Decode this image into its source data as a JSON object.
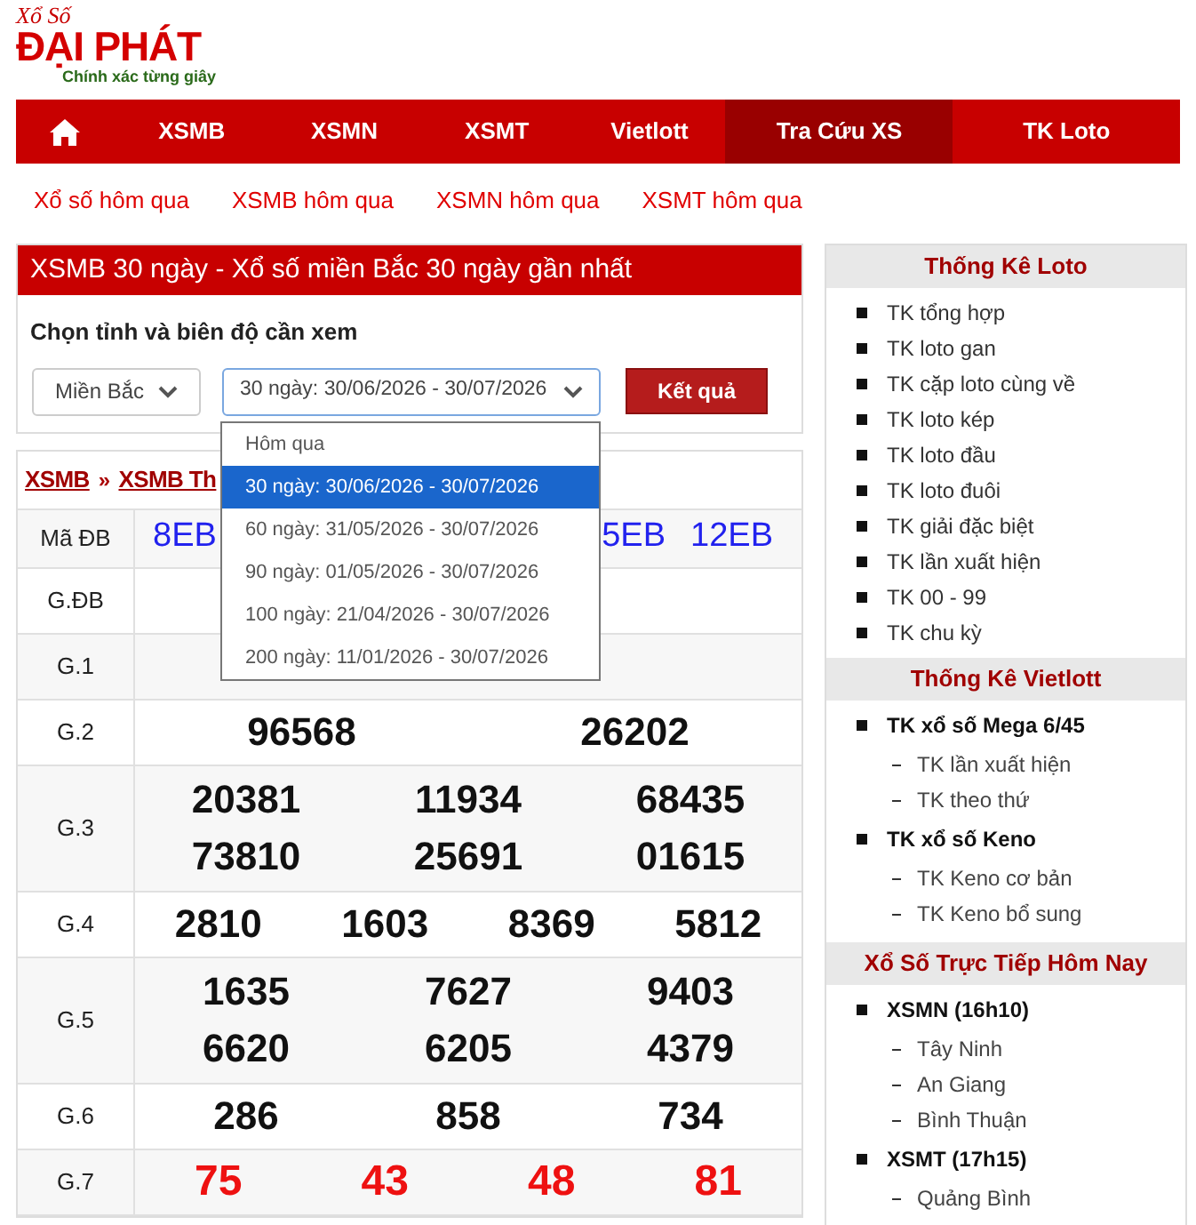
{
  "logo": {
    "brand_top": "Xổ Số",
    "brand": "ĐẠI PHÁT",
    "tagline": "Chính xác từng giây"
  },
  "nav": [
    {
      "kind": "home",
      "selected": false
    },
    {
      "kind": "text",
      "label": "XSMB",
      "selected": false
    },
    {
      "kind": "text",
      "label": "XSMN",
      "selected": false
    },
    {
      "kind": "text",
      "label": "XSMT",
      "selected": false
    },
    {
      "kind": "text",
      "label": "Vietlott",
      "selected": false
    },
    {
      "kind": "text",
      "label": "Tra Cứu XS",
      "selected": true
    },
    {
      "kind": "text",
      "label": "TK Loto",
      "selected": false
    }
  ],
  "quick_links": [
    "Xổ số hôm qua",
    "XSMB hôm qua",
    "XSMN hôm qua",
    "XSMT hôm qua"
  ],
  "panel": {
    "title": "XSMB 30 ngày - Xổ số miền Bắc 30 ngày gần nhất",
    "form_label": "Chọn tỉnh và biên độ cần xem",
    "province_select": {
      "value": "Miền Bắc"
    },
    "range_select": {
      "value": "30 ngày: 30/06/2026 - 30/07/2026",
      "expanded": true,
      "options": [
        {
          "label": "Hôm qua",
          "selected": false
        },
        {
          "label": "30 ngày: 30/06/2026 - 30/07/2026",
          "selected": true
        },
        {
          "label": "60 ngày: 31/05/2026 - 30/07/2026",
          "selected": false
        },
        {
          "label": "90 ngày: 01/05/2026 - 30/07/2026",
          "selected": false
        },
        {
          "label": "100 ngày: 21/04/2026 - 30/07/2026",
          "selected": false
        },
        {
          "label": "200 ngày: 11/01/2026 - 30/07/2026",
          "selected": false
        }
      ]
    },
    "submit": "Kết quả"
  },
  "results": {
    "breadcrumb": [
      "XSMB",
      "XSMB Th"
    ],
    "separator": "»",
    "rows": [
      {
        "label": "Mã ĐB",
        "kind": "codes",
        "lines": [
          [
            "8EB",
            "5EB",
            "12EB"
          ]
        ]
      },
      {
        "label": "G.ĐB",
        "kind": "numbers"
      },
      {
        "label": "G.1",
        "kind": "numbers"
      },
      {
        "label": "G.2",
        "kind": "numbers",
        "lines": [
          [
            "96568",
            "26202"
          ]
        ]
      },
      {
        "label": "G.3",
        "kind": "numbers",
        "lines": [
          [
            "20381",
            "11934",
            "68435"
          ],
          [
            "73810",
            "25691",
            "01615"
          ]
        ]
      },
      {
        "label": "G.4",
        "kind": "numbers",
        "lines": [
          [
            "2810",
            "1603",
            "8369",
            "5812"
          ]
        ]
      },
      {
        "label": "G.5",
        "kind": "numbers",
        "lines": [
          [
            "1635",
            "7627",
            "9403"
          ],
          [
            "6620",
            "6205",
            "4379"
          ]
        ]
      },
      {
        "label": "G.6",
        "kind": "numbers",
        "lines": [
          [
            "286",
            "858",
            "734"
          ]
        ]
      },
      {
        "label": "G.7",
        "kind": "red",
        "lines": [
          [
            "75",
            "43",
            "48",
            "81"
          ]
        ]
      }
    ]
  },
  "sidebar": [
    {
      "title": "Thống Kê Loto",
      "items": [
        {
          "kind": "link",
          "label": "TK tổng hợp"
        },
        {
          "kind": "link",
          "label": "TK loto gan"
        },
        {
          "kind": "link",
          "label": "TK cặp loto cùng về"
        },
        {
          "kind": "link",
          "label": "TK loto kép"
        },
        {
          "kind": "link",
          "label": "TK loto đầu"
        },
        {
          "kind": "link",
          "label": "TK loto đuôi"
        },
        {
          "kind": "link",
          "label": "TK giải đặc biệt"
        },
        {
          "kind": "link",
          "label": "TK lần xuất hiện"
        },
        {
          "kind": "link",
          "label": "TK 00 - 99"
        },
        {
          "kind": "link",
          "label": "TK chu kỳ"
        }
      ]
    },
    {
      "title": "Thống Kê Vietlott",
      "items": [
        {
          "kind": "group",
          "label": "TK xổ số Mega 6/45",
          "children": [
            "TK lần xuất hiện",
            "TK theo thứ"
          ]
        },
        {
          "kind": "group",
          "label": "TK xổ số Keno",
          "children": [
            "TK Keno cơ bản",
            "TK Keno bổ sung"
          ]
        }
      ]
    },
    {
      "title": "Xổ Số Trực Tiếp Hôm Nay",
      "items": [
        {
          "kind": "group",
          "label": "XSMN (16h10)",
          "children": [
            "Tây Ninh",
            "An Giang",
            "Bình Thuận"
          ]
        },
        {
          "kind": "group",
          "label": "XSMT (17h15)",
          "children": [
            "Quảng Bình"
          ]
        }
      ]
    }
  ]
}
